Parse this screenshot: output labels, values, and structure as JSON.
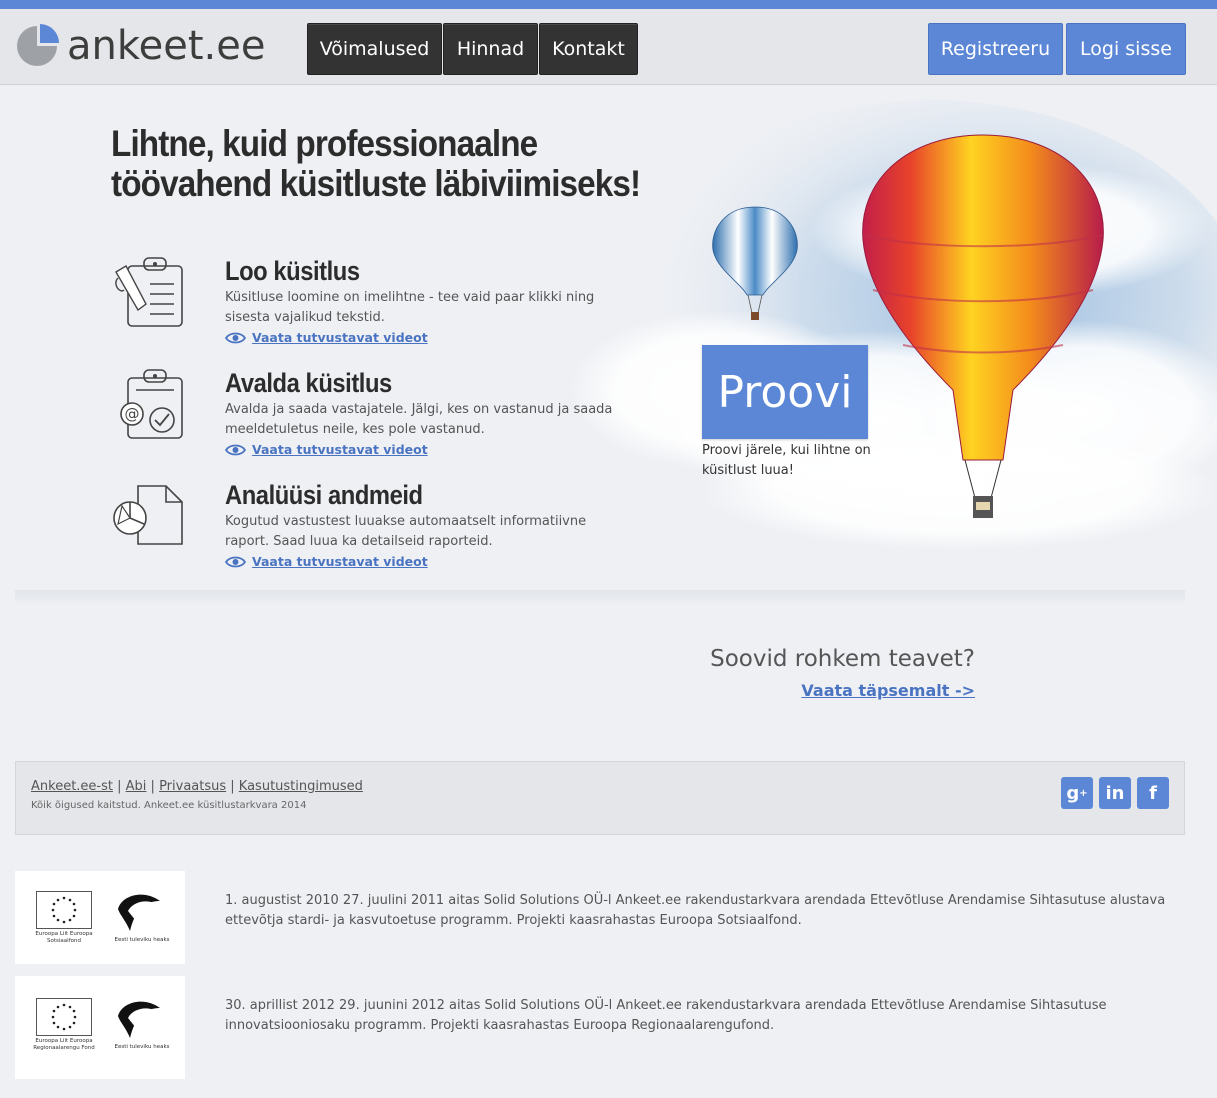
{
  "brand": {
    "name": "ankeet.ee",
    "accent": "#5b87d6",
    "dark_button": "#333333"
  },
  "nav": {
    "items": [
      "Võimalused",
      "Hinnad",
      "Kontakt"
    ],
    "register_label": "Registreeru",
    "login_label": "Logi sisse"
  },
  "hero": {
    "headline_line1": "Lihtne, kuid professionaalne",
    "headline_line2": "töövahend küsitluste läbiviimiseks!",
    "features": [
      {
        "icon": "clipboard-icon",
        "title": "Loo küsitlus",
        "desc": "Küsitluse loomine on imelihtne - tee vaid paar klikki ning sisesta vajalikud tekstid.",
        "link": "Vaata tutvustavat videot"
      },
      {
        "icon": "clipboard-email-icon",
        "title": "Avalda küsitlus",
        "desc": "Avalda ja saada vastajatele. Jälgi, kes on vastanud ja saada meeldetuletus neile, kes pole vastanud.",
        "link": "Vaata tutvustavat videot"
      },
      {
        "icon": "pie-chart-document-icon",
        "title": "Analüüsi andmeid",
        "desc": "Kogutud vastustest luuakse automaatselt informatiivne raport. Saad luua ka detailseid raporteid.",
        "link": "Vaata tutvustavat videot"
      }
    ],
    "cta_label": "Proovi",
    "cta_note": "Proovi järele, kui lihtne on küsitlust luua!"
  },
  "more": {
    "title": "Soovid rohkem teavet?",
    "link": "Vaata täpsemalt ->"
  },
  "footer": {
    "links": [
      "Ankeet.ee-st",
      "Abi",
      "Privaatsus",
      "Kasutustingimused"
    ],
    "copyright": "Kõik õigused kaitstud. Ankeet.ee küsitlustarkvara 2014",
    "social": [
      "google-plus-icon",
      "linkedin-icon",
      "facebook-icon"
    ]
  },
  "eu_blocks": [
    {
      "eu_caption": "Euroopa Liit Euroopa Sotsiaalfond",
      "ee_caption": "Eesti tuleviku heaks",
      "text": "1. augustist 2010 27. juulini 2011 aitas Solid Solutions OÜ-l Ankeet.ee rakendustarkvara arendada Ettevõtluse Arendamise Sihtasutuse alustava ettevõtja stardi- ja kasvutoetuse programm. Projekti kaasrahastas Euroopa Sotsiaalfond."
    },
    {
      "eu_caption": "Euroopa Liit Euroopa Regionaalarengu Fond",
      "ee_caption": "Eesti tuleviku heaks",
      "text": "30. aprillist 2012 29. juunini 2012 aitas Solid Solutions OÜ-l Ankeet.ee rakendustarkvara arendada Ettevõtluse Arendamise Sihtasutuse innovatsiooniosaku programm. Projekti kaasrahastas Euroopa Regionaalarengufond."
    }
  ]
}
